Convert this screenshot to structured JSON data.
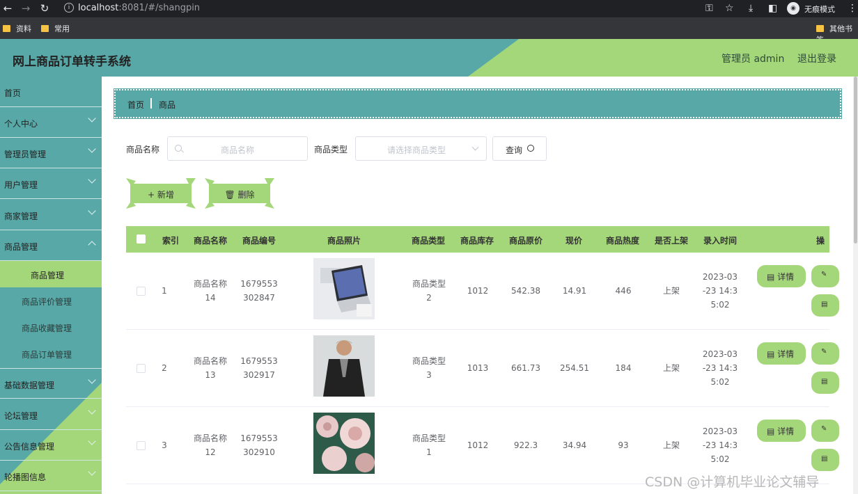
{
  "browser": {
    "url_host": "localhost",
    "url_rest": ":8081/#/shangpin",
    "incognito_label": "无痕模式",
    "bookmarks": [
      "资料",
      "常用"
    ],
    "other_bookmarks": "其他书签"
  },
  "header": {
    "title": "网上商品订单转手系统",
    "admin_label": "管理员 admin",
    "logout_label": "退出登录"
  },
  "sidebar": {
    "items": [
      {
        "label": "首页",
        "chevron": false
      },
      {
        "label": "个人中心",
        "chevron": true
      },
      {
        "label": "管理员管理",
        "chevron": true
      },
      {
        "label": "用户管理",
        "chevron": true
      },
      {
        "label": "商家管理",
        "chevron": true
      },
      {
        "label": "商品管理",
        "chevron": true
      }
    ],
    "sub_items": [
      "商品管理",
      "商品评价管理",
      "商品收藏管理",
      "商品订单管理"
    ],
    "items_after": [
      {
        "label": "基础数据管理"
      },
      {
        "label": "论坛管理"
      },
      {
        "label": "公告信息管理"
      },
      {
        "label": "轮播图信息"
      }
    ]
  },
  "breadcrumb": {
    "home": "首页",
    "current": "商品"
  },
  "filters": {
    "name_label": "商品名称",
    "name_placeholder": "商品名称",
    "type_label": "商品类型",
    "type_placeholder": "请选择商品类型",
    "query_label": "查询"
  },
  "actions": {
    "add_label": "新增",
    "delete_label": "删除"
  },
  "table": {
    "headers": [
      "索引",
      "商品名称",
      "商品编号",
      "商品照片",
      "商品类型",
      "商品库存",
      "商品原价",
      "现价",
      "商品热度",
      "是否上架",
      "录入时间",
      "操"
    ],
    "detail_label": "详情",
    "rows": [
      {
        "index": "1",
        "name": [
          "商品名称",
          "14"
        ],
        "code": [
          "1679553",
          "302847"
        ],
        "type": [
          "商品类型",
          "2"
        ],
        "stock": "1012",
        "orig_price": "542.38",
        "price": "14.91",
        "heat": "446",
        "status": "上架",
        "time": [
          "2023-03",
          "-23 14:3",
          "5:02"
        ],
        "photo": "laptop"
      },
      {
        "index": "2",
        "name": [
          "商品名称",
          "13"
        ],
        "code": [
          "1679553",
          "302917"
        ],
        "type": [
          "商品类型",
          "3"
        ],
        "stock": "1013",
        "orig_price": "661.73",
        "price": "254.51",
        "heat": "184",
        "status": "上架",
        "time": [
          "2023-03",
          "-23 14:3",
          "5:02"
        ],
        "photo": "jacket"
      },
      {
        "index": "3",
        "name": [
          "商品名称",
          "12"
        ],
        "code": [
          "1679553",
          "302910"
        ],
        "type": [
          "商品类型",
          "1"
        ],
        "stock": "1012",
        "orig_price": "922.3",
        "price": "34.94",
        "heat": "93",
        "status": "上架",
        "time": [
          "2023-03",
          "-23 14:3",
          "5:02"
        ],
        "photo": "roses"
      }
    ]
  },
  "watermark": "CSDN @计算机毕业论文辅导",
  "colors": {
    "teal": "#58a8a7",
    "green": "#a4d67a"
  }
}
